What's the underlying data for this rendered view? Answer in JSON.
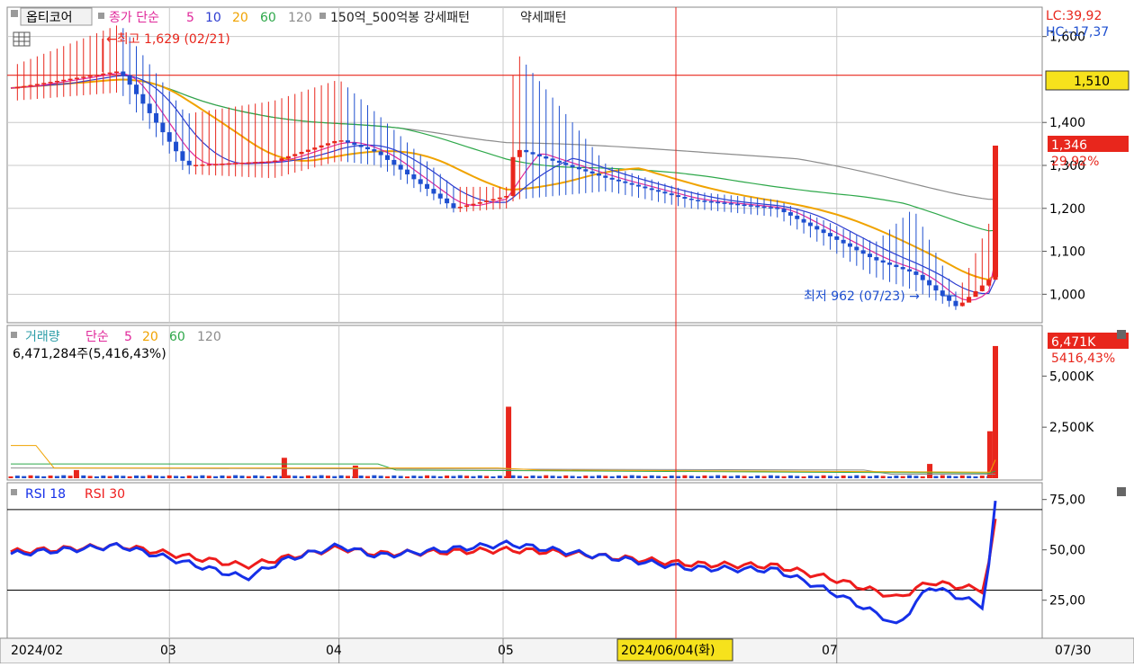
{
  "colors": {
    "up": "#e8261c",
    "down": "#1e4fd0",
    "ma5": "#e0289a",
    "ma10": "#2c3bd0",
    "ma20": "#f0a300",
    "ma60": "#2ea84a",
    "ma120": "#8c8c8c",
    "rsi18": "#1630e8",
    "rsi30": "#ee1c1c",
    "grid": "#c8c8c8"
  },
  "header": {
    "stock_name": "옵티코어",
    "ma_label": "종가 단순",
    "ma_periods": [
      "5",
      "10",
      "20",
      "60",
      "120"
    ],
    "pattern_label": "150억_500억봉 강세패턴",
    "pattern2_label": "약세패턴",
    "lc": "LC:39,92",
    "hc": "HC:-17,37"
  },
  "price_panel": {
    "high_annot": "←최고 1,629 (02/21)",
    "low_annot": "최저 962 (07/23) →",
    "hline_label": "1,510",
    "last_price": "1,346",
    "last_change": "29,92%",
    "y_ticks": [
      "1,600",
      "1,400",
      "1,300",
      "1,200",
      "1,100",
      "1,000"
    ]
  },
  "volume_panel": {
    "title": "거래량",
    "ma_label": "단순",
    "ma_periods": [
      "5",
      "20",
      "60",
      "120"
    ],
    "volume_text": "6,471,284주(5,416,43%)",
    "last_volume": "6,471K",
    "last_ratio": "5416,43%",
    "y_ticks": [
      "5,000K",
      "2,500K"
    ]
  },
  "rsi_panel": {
    "label1": "RSI 18",
    "label2": "RSI 30",
    "y_ticks": [
      "75,00",
      "50,00",
      "25,00"
    ]
  },
  "x_axis": {
    "labels": [
      "2024/02",
      "03",
      "04",
      "05",
      "07"
    ],
    "crosshair_label": "2024/06/04(화)",
    "last_label": "07/30"
  },
  "chart_data": [
    {
      "type": "candlestick",
      "title": "옵티코어",
      "x": [
        "2024/02/01",
        "2024/02/21",
        "2024/03/04",
        "2024/03/20",
        "2024/04/01",
        "2024/04/08",
        "2024/04/22",
        "2024/05/02",
        "2024/05/03",
        "2024/05/20",
        "2024/06/04",
        "2024/06/20",
        "2024/07/08",
        "2024/07/15",
        "2024/07/23",
        "2024/07/29",
        "2024/07/30"
      ],
      "close": [
        1480,
        1520,
        1300,
        1310,
        1360,
        1330,
        1200,
        1230,
        1340,
        1270,
        1220,
        1200,
        1080,
        1050,
        970,
        1036,
        1346
      ],
      "high": [
        1530,
        1629,
        1420,
        1450,
        1500,
        1420,
        1250,
        1250,
        1570,
        1300,
        1240,
        1220,
        1120,
        1200,
        1000,
        1170,
        1346
      ],
      "low": [
        1450,
        1470,
        1280,
        1270,
        1310,
        1300,
        1190,
        1200,
        1220,
        1240,
        1200,
        1180,
        1040,
        1010,
        962,
        1020,
        1040
      ],
      "hline": 1510,
      "ylim": [
        940,
        1660
      ]
    },
    {
      "type": "bar",
      "title": "거래량",
      "x": [
        "2024/02/13",
        "2024/03/22",
        "2024/04/04",
        "2024/05/02",
        "2024/07/18",
        "2024/07/29",
        "2024/07/30"
      ],
      "values": [
        400,
        1000,
        620,
        3500,
        700,
        2300,
        6471
      ],
      "unit": "K",
      "last_value": 6471284
    },
    {
      "type": "line",
      "series": [
        {
          "name": "RSI 18",
          "x": [
            "2024/02/01",
            "2024/02/21",
            "2024/03/15",
            "2024/03/22",
            "2024/04/01",
            "2024/04/08",
            "2024/05/02",
            "2024/05/10",
            "2024/06/04",
            "2024/06/20",
            "2024/07/01",
            "2024/07/10",
            "2024/07/12",
            "2024/07/18",
            "2024/07/28",
            "2024/07/30"
          ],
          "values": [
            48,
            52,
            36,
            45,
            52,
            47,
            53,
            50,
            41,
            40,
            28,
            16,
            12,
            32,
            22,
            73
          ]
        },
        {
          "name": "RSI 30",
          "x": [
            "2024/02/01",
            "2024/02/21",
            "2024/03/15",
            "2024/03/22",
            "2024/04/01",
            "2024/04/08",
            "2024/05/02",
            "2024/05/10",
            "2024/06/04",
            "2024/06/20",
            "2024/07/01",
            "2024/07/10",
            "2024/07/12",
            "2024/07/18",
            "2024/07/28",
            "2024/07/30"
          ],
          "values": [
            49,
            52,
            42,
            46,
            51,
            48,
            50,
            49,
            43,
            42,
            35,
            28,
            26,
            34,
            30,
            64
          ]
        }
      ],
      "hlines": [
        70,
        30
      ],
      "ylim": [
        7,
        82
      ]
    }
  ]
}
